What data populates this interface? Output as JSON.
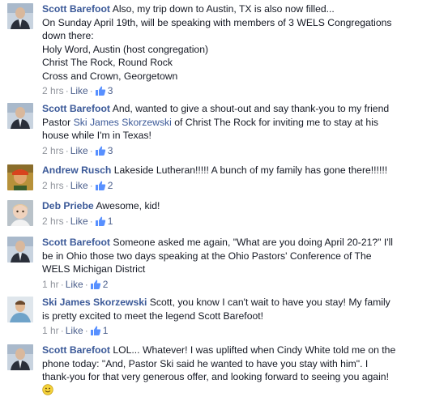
{
  "comments": [
    {
      "author": "Scott Barefoot",
      "avatar": "scott-avatar",
      "lines": [
        "Also, my trip down to Austin, TX is also now filled...",
        "On Sunday April 19th, will be speaking with members of 3 WELS Congregations",
        "down there:",
        "Holy Word, Austin (host congregation)",
        "Christ The Rock, Round Rock",
        "Cross and Crown, Georgetown"
      ],
      "time": "2 hrs",
      "like_label": "Like",
      "like_count": "3"
    },
    {
      "author": "Scott Barefoot",
      "avatar": "scott-avatar",
      "line1_text": "And, wanted to give a shout-out and say thank-you to my friend",
      "line2_prefix": "Pastor ",
      "mention": "Ski James Skorzewski",
      "line2_suffix": " of Christ The Rock for inviting me to stay at his",
      "line3": "house while I'm in Texas!",
      "time": "2 hrs",
      "like_label": "Like",
      "like_count": "3"
    },
    {
      "author": "Andrew Rusch",
      "avatar": "andrew-avatar",
      "text": "Lakeside Lutheran!!!!! A bunch of my family has gone there!!!!!!",
      "time": "2 hrs",
      "like_label": "Like",
      "like_count": "2"
    },
    {
      "author": "Deb Priebe",
      "avatar": "deb-avatar",
      "text": "Awesome, kid!",
      "time": "2 hrs",
      "like_label": "Like",
      "like_count": "1"
    },
    {
      "author": "Scott Barefoot",
      "avatar": "scott-avatar",
      "line1_text": "Someone asked me again, \"What are you doing April 20-21?\" I'll",
      "line2": "be in Ohio those two days speaking at the Ohio Pastors' Conference of The",
      "line3": "WELS Michigan District",
      "time": "1 hr",
      "like_label": "Like",
      "like_count": "2"
    },
    {
      "author": "Ski James Skorzewski",
      "avatar": "ski-avatar",
      "line1_text": "Scott, you know I can't wait to have you stay! My family",
      "line2": "is pretty excited to meet the legend Scott Barefoot!",
      "time": "1 hr",
      "like_label": "Like",
      "like_count": "1"
    },
    {
      "author": "Scott Barefoot",
      "avatar": "scott-avatar",
      "line1_text": "LOL... Whatever! I was uplifted when Cindy White told me on the",
      "line2": "phone today: \"And, Pastor Ski said he wanted to have you stay with him\". I",
      "line3": "thank-you for that very generous offer, and looking forward to seeing you again!",
      "emoji": "smile-emoticon"
    }
  ],
  "colors": {
    "link": "#3b5998",
    "meta": "#90949c",
    "like": "#4b5f8c"
  }
}
